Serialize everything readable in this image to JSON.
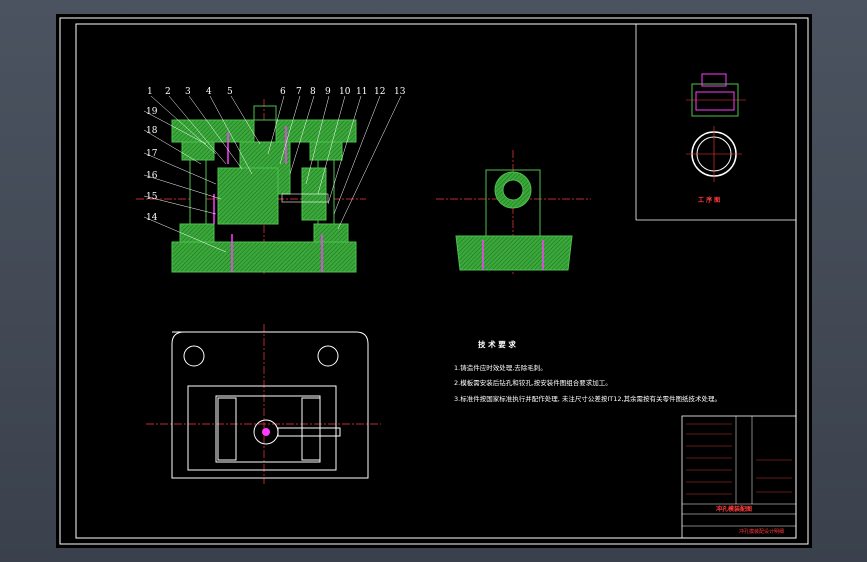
{
  "balloons": {
    "top": [
      "1",
      "2",
      "3",
      "4",
      "5",
      "6",
      "7",
      "8",
      "9",
      "10",
      "11",
      "12",
      "13"
    ],
    "left": [
      "19",
      "18",
      "17",
      "16",
      "15",
      "14"
    ]
  },
  "views": {
    "process_label": "工 序 图"
  },
  "tech_requirements": {
    "title": "技 术 要 求",
    "items": [
      "1.铸造件应时效处理,去除毛刺。",
      "2.模板需安装后钻孔和铰孔,按安装件图组合要求加工。",
      "3.标准件按国家标准执行并配作处理, 未注尺寸公差按IT12,其余需按有关零件图纸技术处理。"
    ]
  },
  "title_block": {
    "drawing_name": "冲孔模装配图",
    "subtitle": "冲孔模装配设计明细"
  },
  "colors": {
    "green": "#4bc34b",
    "red": "#ff3a3a",
    "magenta": "#ff3cff",
    "white": "#ffffff",
    "background": "#000000"
  }
}
